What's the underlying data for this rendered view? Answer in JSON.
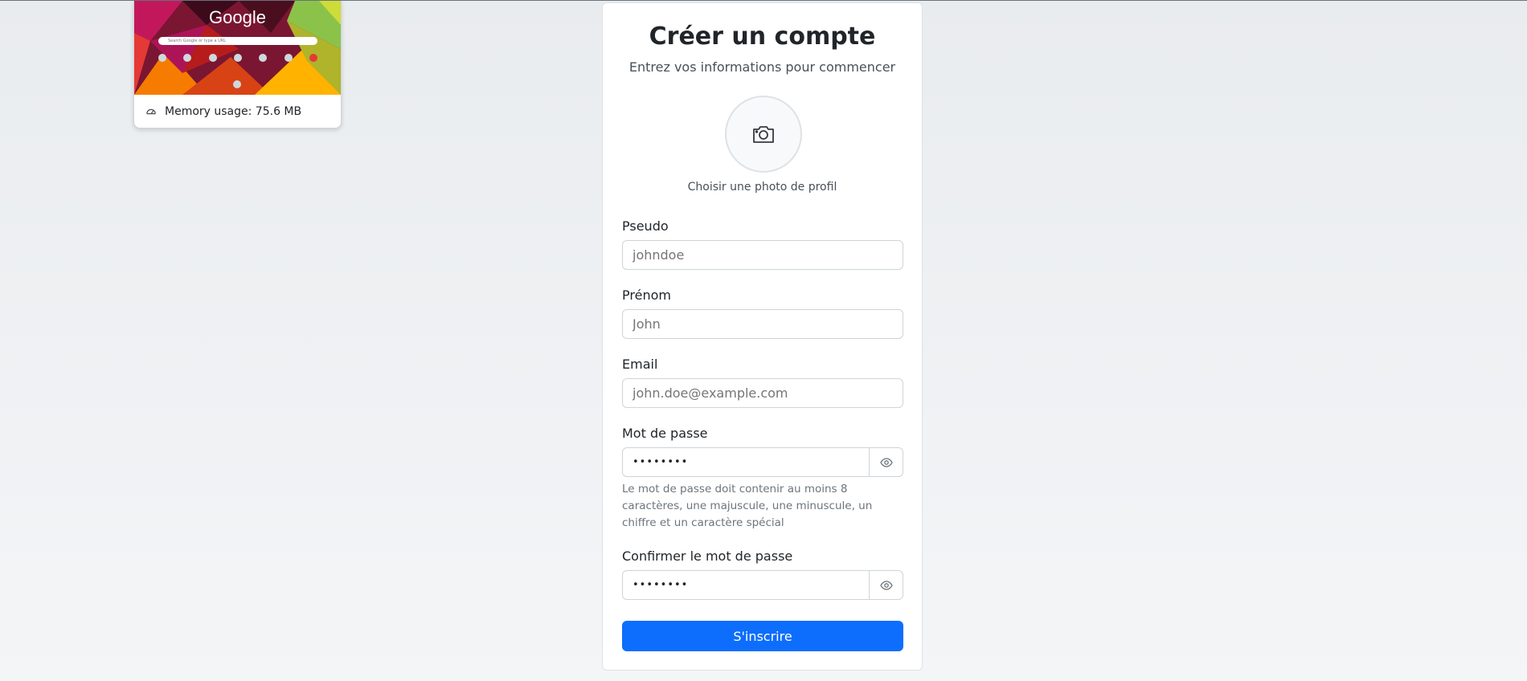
{
  "memory_tooltip": {
    "thumbnail_logo": "Google",
    "search_placeholder": "Search Google or type a URL",
    "label": "Memory usage: 75.6 MB"
  },
  "form": {
    "title": "Créer un compte",
    "subtitle": "Entrez vos informations pour commencer",
    "avatar_label": "Choisir une photo de profil",
    "fields": {
      "pseudo": {
        "label": "Pseudo",
        "placeholder": "johndoe"
      },
      "prenom": {
        "label": "Prénom",
        "placeholder": "John"
      },
      "email": {
        "label": "Email",
        "placeholder": "john.doe@example.com"
      },
      "password": {
        "label": "Mot de passe",
        "value": "••••••••",
        "help": "Le mot de passe doit contenir au moins 8 caractères, une majuscule, une minuscule, un chiffre et un caractère spécial"
      },
      "confirm_password": {
        "label": "Confirmer le mot de passe",
        "value": "••••••••"
      }
    },
    "submit_label": "S'inscrire"
  },
  "colors": {
    "primary": "#0d6efd",
    "background": "#eef0f3"
  }
}
